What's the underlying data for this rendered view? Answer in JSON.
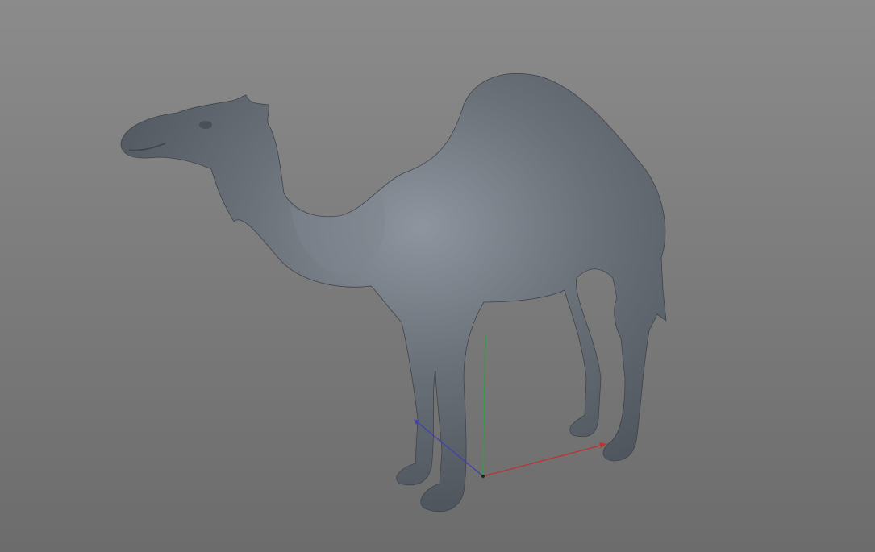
{
  "viewport": {
    "model": "camel",
    "colors": {
      "background_top": "#8b8b8b",
      "background_bottom": "#6c6c6c",
      "model_base": "#596068",
      "model_highlight": "#8e959e",
      "axis_x": "#c03030",
      "axis_y": "#30a040",
      "axis_z": "#4040b0"
    }
  }
}
